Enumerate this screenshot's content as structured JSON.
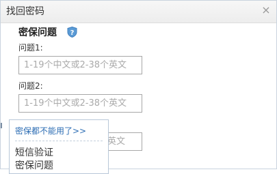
{
  "dialog": {
    "title": "找回密码",
    "close_glyph": "×"
  },
  "section": {
    "title": "密保问题",
    "help_icon": "shield-question-icon"
  },
  "questions": [
    {
      "label": "问题1:",
      "placeholder": "1-19个中文或2-38个英文"
    },
    {
      "label": "问题2:",
      "placeholder": "1-19个中文或2-38个英文"
    },
    {
      "placeholder_visible_part": "英文"
    }
  ],
  "popup": {
    "header": "密保都不能用了>>",
    "items": [
      "短信验证",
      "密保问题"
    ]
  },
  "colors": {
    "link": "#2b6cb3",
    "border": "#a7a7a7",
    "placeholder": "#aaaaaa",
    "help_icon": "#5b9bd5"
  }
}
